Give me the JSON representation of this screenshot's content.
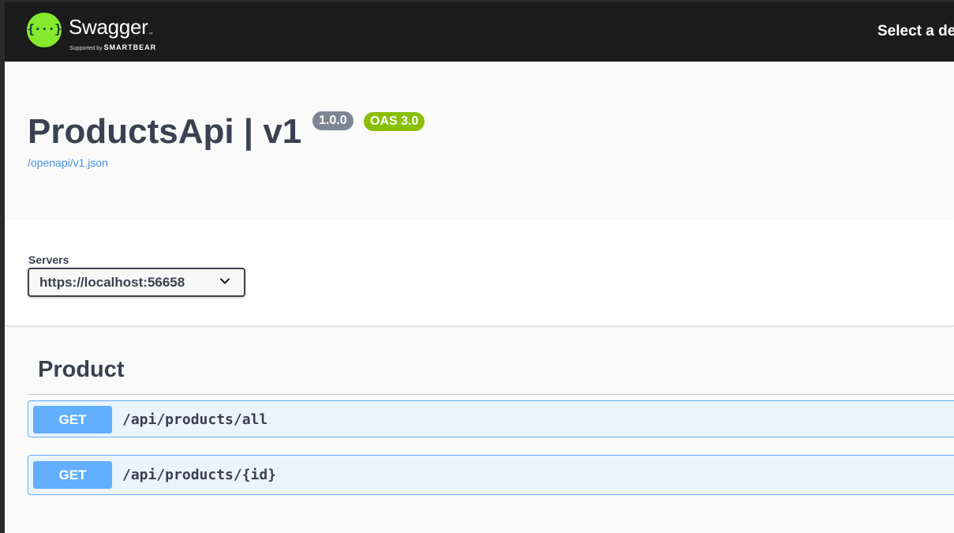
{
  "header": {
    "brand_name": "Swagger",
    "brand_tm": "™",
    "brand_supported_by": "Supported by",
    "brand_company": "SMARTBEAR",
    "select_definition_label": "Select a de",
    "logo_icon": "swagger-braces-icon"
  },
  "info": {
    "title": "ProductsApi | v1",
    "version_badge": "1.0.0",
    "oas_badge": "OAS 3.0",
    "spec_link": "/openapi/v1.json"
  },
  "servers": {
    "label": "Servers",
    "selected": "https://localhost:56658"
  },
  "tag": {
    "name": "Product",
    "operations": [
      {
        "method": "GET",
        "path": "/api/products/all"
      },
      {
        "method": "GET",
        "path": "/api/products/{id}"
      }
    ]
  },
  "colors": {
    "topbar": "#1b1b1b",
    "logo_green": "#85ea2d",
    "get_blue": "#61affe",
    "get_bg": "#ebf3fb",
    "oas_green": "#89bf04",
    "version_gray": "#7d8492",
    "text_dark": "#3b4151",
    "link_blue": "#4990e2"
  }
}
